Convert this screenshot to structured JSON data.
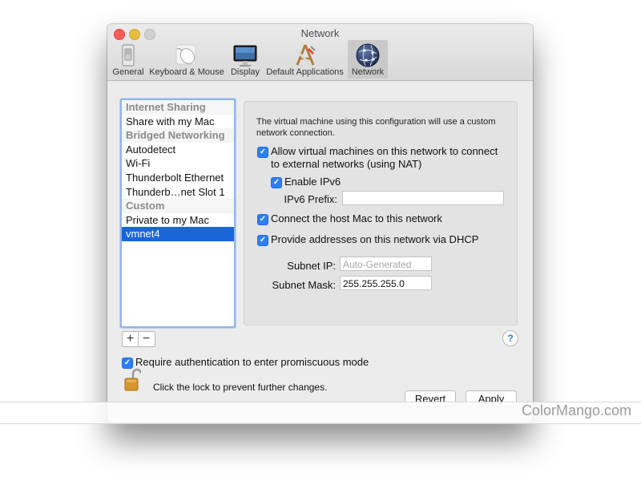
{
  "window": {
    "title": "Network"
  },
  "toolbar": {
    "items": [
      {
        "label": "General",
        "icon": "switch-icon"
      },
      {
        "label": "Keyboard & Mouse",
        "icon": "mouse-icon"
      },
      {
        "label": "Display",
        "icon": "display-icon"
      },
      {
        "label": "Default Applications",
        "icon": "applications-icon"
      },
      {
        "label": "Network",
        "icon": "globe-icon",
        "active": true
      }
    ]
  },
  "sidebar": {
    "rows": [
      {
        "label": "Internet Sharing",
        "type": "header"
      },
      {
        "label": "Share with my Mac",
        "type": "item"
      },
      {
        "label": "Bridged Networking",
        "type": "header"
      },
      {
        "label": "Autodetect",
        "type": "item"
      },
      {
        "label": "Wi-Fi",
        "type": "item"
      },
      {
        "label": "Thunderbolt Ethernet",
        "type": "item"
      },
      {
        "label": "Thunderb…net Slot 1",
        "type": "item"
      },
      {
        "label": "Custom",
        "type": "header"
      },
      {
        "label": "Private to my Mac",
        "type": "item"
      },
      {
        "label": "vmnet4",
        "type": "item",
        "selected": true
      }
    ],
    "add_label": "+",
    "remove_label": "−"
  },
  "panel": {
    "description": "The virtual machine using this configuration will use a custom network connection.",
    "allow_nat": {
      "label_line1": "Allow virtual machines on this network to connect",
      "label_line2": "to external networks (using NAT)",
      "checked": true
    },
    "enable_ipv6": {
      "label": "Enable IPv6",
      "checked": true
    },
    "ipv6_prefix": {
      "label": "IPv6 Prefix:",
      "value": ""
    },
    "connect_host": {
      "label": "Connect the host Mac to this network",
      "checked": true
    },
    "dhcp": {
      "label": "Provide addresses on this network via DHCP",
      "checked": true
    },
    "subnet_ip": {
      "label": "Subnet IP:",
      "placeholder": "Auto-Generated"
    },
    "subnet_mask": {
      "label": "Subnet Mask:",
      "value": "255.255.255.0"
    }
  },
  "help_label": "?",
  "promiscuous": {
    "label": "Require authentication to enter promiscuous mode",
    "checked": true
  },
  "lock": {
    "text": "Click the lock to prevent further changes.",
    "icon": "lock-icon"
  },
  "buttons": {
    "revert": "Revert",
    "apply": "Apply"
  },
  "watermark": "ColorMango.com",
  "colors": {
    "selection": "#1a66d9",
    "checkbox": "#2d7ff9",
    "close": "#fc5b57",
    "minimize": "#e5bf3c"
  }
}
